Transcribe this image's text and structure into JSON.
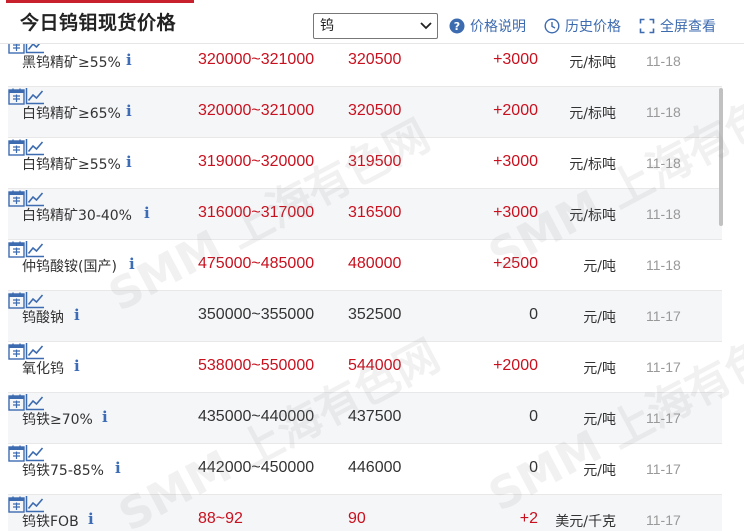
{
  "header": {
    "title": "今日钨钼现货价格",
    "select_value": "钨",
    "links": [
      {
        "label": "价格说明",
        "icon": "question-circle-icon"
      },
      {
        "label": "历史价格",
        "icon": "clock-icon"
      },
      {
        "label": "全屏查看",
        "icon": "fullscreen-icon"
      }
    ]
  },
  "watermark": "SMM 上海有色网",
  "colors": {
    "accent": "#c9202d",
    "up": "#c8101e",
    "link": "#3d6bb0",
    "date": "#999999"
  },
  "rows": [
    {
      "name": "黑钨精矿≥55%",
      "range": "320000~321000",
      "avg": "320500",
      "change": "+3000",
      "unit": "元/标吨",
      "date": "11-18",
      "dir": "up"
    },
    {
      "name": "白钨精矿≥65%",
      "range": "320000~321000",
      "avg": "320500",
      "change": "+2000",
      "unit": "元/标吨",
      "date": "11-18",
      "dir": "up"
    },
    {
      "name": "白钨精矿≥55%",
      "range": "319000~320000",
      "avg": "319500",
      "change": "+3000",
      "unit": "元/标吨",
      "date": "11-18",
      "dir": "up"
    },
    {
      "name": "白钨精矿30-40%",
      "range": "316000~317000",
      "avg": "316500",
      "change": "+3000",
      "unit": "元/标吨",
      "date": "11-18",
      "dir": "up"
    },
    {
      "name": "仲钨酸铵(国产)",
      "range": "475000~485000",
      "avg": "480000",
      "change": "+2500",
      "unit": "元/吨",
      "date": "11-18",
      "dir": "up"
    },
    {
      "name": "钨酸钠",
      "range": "350000~355000",
      "avg": "352500",
      "change": "0",
      "unit": "元/吨",
      "date": "11-17",
      "dir": "flat"
    },
    {
      "name": "氧化钨",
      "range": "538000~550000",
      "avg": "544000",
      "change": "+2000",
      "unit": "元/吨",
      "date": "11-17",
      "dir": "up"
    },
    {
      "name": "钨铁≥70%",
      "range": "435000~440000",
      "avg": "437500",
      "change": "0",
      "unit": "元/吨",
      "date": "11-17",
      "dir": "flat"
    },
    {
      "name": "钨铁75-85%",
      "range": "442000~450000",
      "avg": "446000",
      "change": "0",
      "unit": "元/吨",
      "date": "11-17",
      "dir": "flat"
    },
    {
      "name": "钨铁FOB",
      "range": "88~92",
      "avg": "90",
      "change": "+2",
      "unit": "美元/千克",
      "date": "11-17",
      "dir": "up"
    }
  ]
}
